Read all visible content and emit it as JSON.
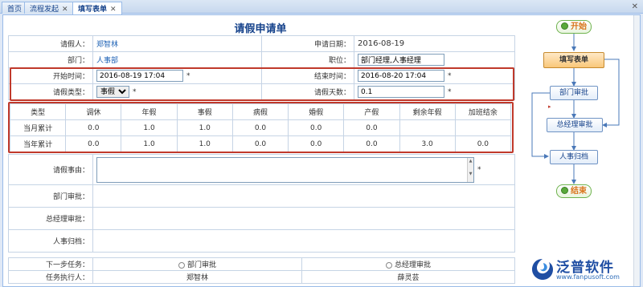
{
  "tabs": [
    {
      "label": "首页",
      "closable": false
    },
    {
      "label": "流程发起",
      "closable": true
    },
    {
      "label": "填写表单",
      "closable": true
    }
  ],
  "form": {
    "title": "请假申请单",
    "applicant_label": "请假人：",
    "applicant_value": "郑智林",
    "apply_date_label": "申请日期：",
    "apply_date_value": "2016-08-19",
    "dept_label": "部门：",
    "dept_value": "人事部",
    "position_label": "职位：",
    "position_value": "部门经理,人事经理",
    "start_label": "开始时间：",
    "start_value": "2016-08-19 17:04",
    "end_label": "结束时间：",
    "end_value": "2016-08-20 17:04",
    "type_label": "请假类型：",
    "type_value": "事假",
    "days_label": "请假天数：",
    "days_value": "0.1",
    "required_mark": "*",
    "reason_label": "请假事由：",
    "dept_approve_label": "部门审批：",
    "gm_approve_label": "总经理审批：",
    "hr_label": "人事归档：",
    "next_task_label": "下一步任务：",
    "next_task_options": [
      "部门审批",
      "总经理审批"
    ],
    "executor_label": "任务执行人：",
    "executors": [
      "郑智林",
      "薛灵芸"
    ]
  },
  "leave_table": {
    "headers": [
      "类型",
      "调休",
      "年假",
      "事假",
      "病假",
      "婚假",
      "产假",
      "剩余年假",
      "加班结余"
    ],
    "rows": [
      [
        "当月累计",
        "0.0",
        "1.0",
        "1.0",
        "0.0",
        "0.0",
        "0.0",
        "",
        ""
      ],
      [
        "当年累计",
        "0.0",
        "1.0",
        "1.0",
        "0.0",
        "0.0",
        "0.0",
        "3.0",
        "0.0"
      ]
    ]
  },
  "flow": {
    "start": "开始",
    "fill_form": "填写表单",
    "dept_approve": "部门审批",
    "gm_approve": "总经理审批",
    "hr_archive": "人事归档",
    "end": "结束"
  },
  "logo": {
    "name": "泛普软件",
    "url": "www.fanpusoft.com"
  }
}
